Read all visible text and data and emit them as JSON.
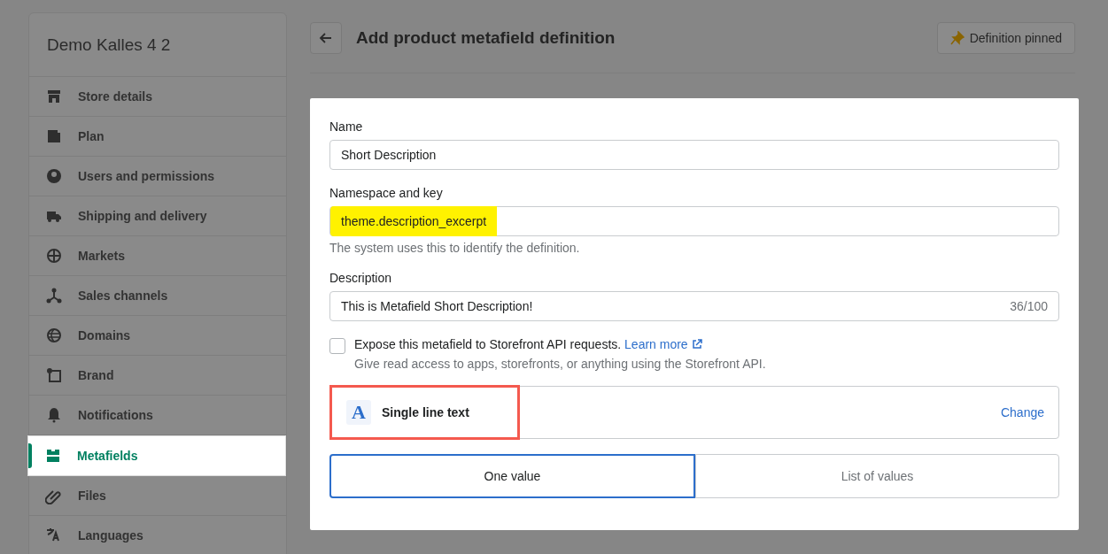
{
  "sidebar": {
    "store_name": "Demo Kalles 4 2",
    "items": [
      {
        "label": "Store details",
        "selected": false
      },
      {
        "label": "Plan",
        "selected": false
      },
      {
        "label": "Users and permissions",
        "selected": false
      },
      {
        "label": "Shipping and delivery",
        "selected": false
      },
      {
        "label": "Markets",
        "selected": false
      },
      {
        "label": "Sales channels",
        "selected": false
      },
      {
        "label": "Domains",
        "selected": false
      },
      {
        "label": "Brand",
        "selected": false
      },
      {
        "label": "Notifications",
        "selected": false
      },
      {
        "label": "Metafields",
        "selected": true
      },
      {
        "label": "Files",
        "selected": false
      },
      {
        "label": "Languages",
        "selected": false
      }
    ]
  },
  "header": {
    "title": "Add product metafield definition",
    "pin_button": "Definition pinned"
  },
  "form": {
    "fields": [
      {
        "label": "Name",
        "value": "Short Description",
        "highlighted": false
      },
      {
        "label": "Namespace and key",
        "value": "theme.description_excerpt",
        "highlighted": true,
        "help": "The system uses this to identify the definition."
      },
      {
        "label": "Description",
        "value": "This is Metafield Short Description!",
        "highlighted": false,
        "counter": "36/100"
      }
    ],
    "expose": {
      "checked": false,
      "label": "Expose this metafield to Storefront API requests.",
      "link": "Learn more",
      "help": "Give read access to apps, storefronts, or anything using the Storefront API."
    },
    "type": {
      "icon_letter": "A",
      "label": "Single line text",
      "outlined": true,
      "action": "Change"
    },
    "value_options": [
      {
        "label": "One value",
        "selected": true
      },
      {
        "label": "List of values",
        "selected": false
      }
    ]
  }
}
